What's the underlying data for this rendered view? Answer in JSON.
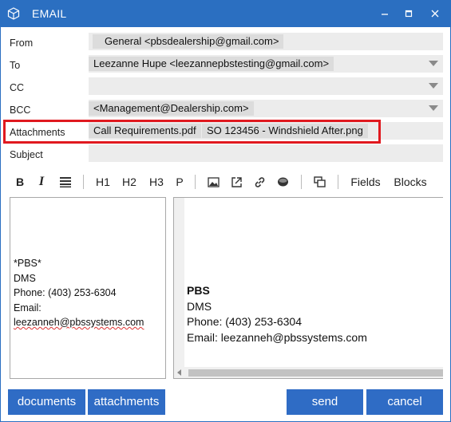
{
  "window": {
    "title": "EMAIL"
  },
  "labels": {
    "from": "From",
    "to": "To",
    "cc": "CC",
    "bcc": "BCC",
    "attachments": "Attachments",
    "subject": "Subject"
  },
  "fields": {
    "from_value": "General  <pbsdealership@gmail.com>",
    "to_value": "Leezanne Hupe <leezannepbstesting@gmail.com>",
    "cc_value": "",
    "bcc_value": "<Management@Dealership.com>",
    "attachments": [
      "Call Requirements.pdf",
      "SO 123456 - Windshield After.png"
    ],
    "subject_value": ""
  },
  "toolbar": {
    "bold": "B",
    "italic": "I",
    "h1": "H1",
    "h2": "H2",
    "h3": "H3",
    "p": "P",
    "fields": "Fields",
    "blocks": "Blocks"
  },
  "editor_left": {
    "line1": "*PBS*",
    "line2": "DMS",
    "line3": "Phone: (403) 253-6304",
    "line4": "Email:",
    "line5": "leezanneh@pbssystems.com"
  },
  "editor_right": {
    "line1": "PBS",
    "line2": "DMS",
    "line3": "Phone: (403) 253-6304",
    "line4": "Email: leezanneh@pbssystems.com"
  },
  "buttons": {
    "documents": "documents",
    "attachments": "attachments",
    "send": "send",
    "cancel": "cancel"
  },
  "colors": {
    "titlebar": "#2b6fc1",
    "button": "#2f6cc5",
    "highlight": "#e0191f",
    "field_bg": "#ececec",
    "chip_bg": "#dcdcdc"
  }
}
